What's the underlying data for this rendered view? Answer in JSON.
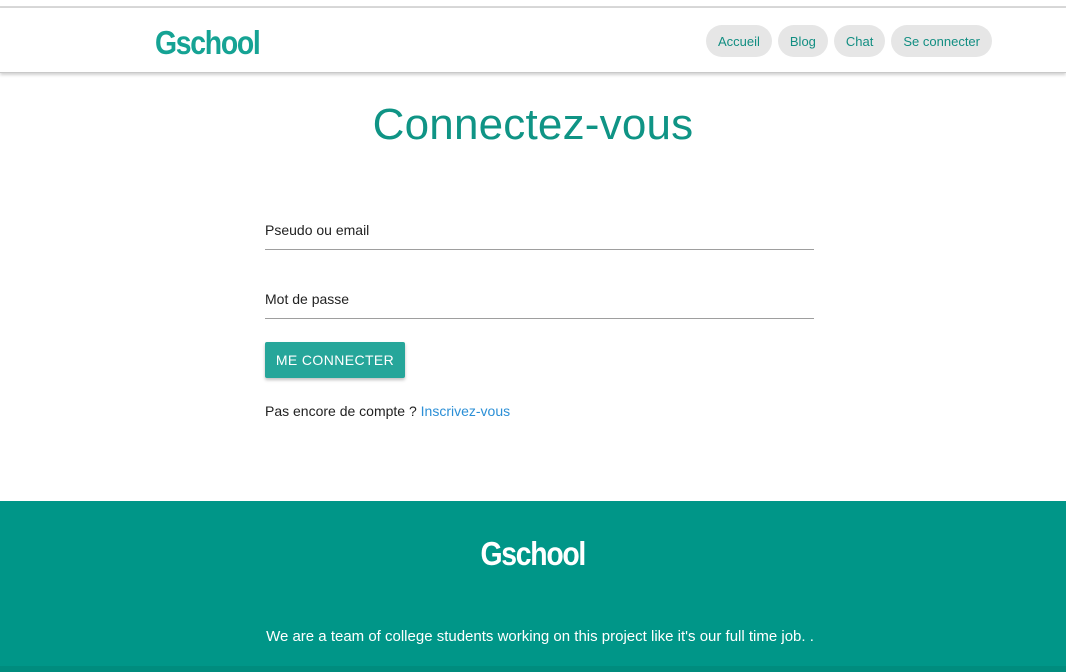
{
  "header": {
    "logo": "Gschool",
    "nav": [
      "Accueil",
      "Blog",
      "Chat",
      "Se connecter"
    ]
  },
  "login": {
    "title": "Connectez-vous",
    "username_placeholder": "Pseudo ou email",
    "password_placeholder": "Mot de passe",
    "submit_label": "ME CONNECTER",
    "signup_prompt": "Pas encore de compte ?",
    "signup_link": "Inscrivez-vous"
  },
  "footer": {
    "logo": "Gschool",
    "tagline": "We are a team of college students working on this project like it's our full time job. ."
  },
  "colors": {
    "accent": "#009688",
    "button": "#26a69a",
    "link": "#2b8fd6",
    "nav_pill_bg": "#e6e6e6"
  }
}
